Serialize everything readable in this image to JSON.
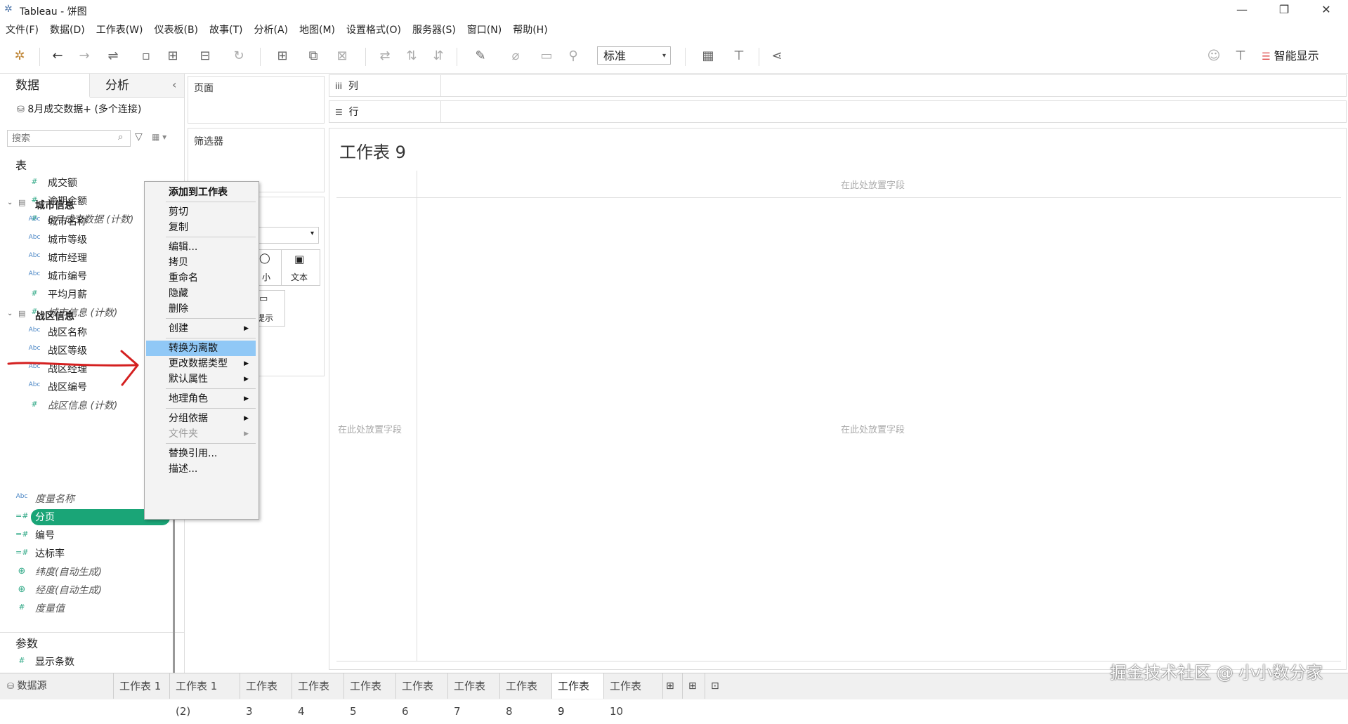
{
  "window": {
    "title": "Tableau - 饼图",
    "minimize": "—",
    "maximize": "❐",
    "close": "✕"
  },
  "menu": [
    "文件(F)",
    "数据(D)",
    "工作表(W)",
    "仪表板(B)",
    "故事(T)",
    "分析(A)",
    "地图(M)",
    "设置格式(O)",
    "服务器(S)",
    "窗口(N)",
    "帮助(H)"
  ],
  "toolbar": {
    "view_size": "标准",
    "show_me": "智能显示"
  },
  "left_panel": {
    "tab_data": "数据",
    "tab_analysis": "分析",
    "collapse": "‹",
    "datasource": "8月成交数据+ (多个连接)",
    "search_placeholder": "搜索",
    "tables_header": "表",
    "table_fields": [
      {
        "name": "成交额",
        "icon": "#",
        "italic": false
      },
      {
        "name": "逾期金额",
        "icon": "#",
        "italic": false
      },
      {
        "name": "8月成交数据 (计数)",
        "icon": "#",
        "italic": true
      }
    ],
    "group_city": {
      "name": "城市信息",
      "fields": [
        {
          "name": "城市名称",
          "icon": "Abc",
          "italic": false
        },
        {
          "name": "城市等级",
          "icon": "Abc",
          "italic": false
        },
        {
          "name": "城市经理",
          "icon": "Abc",
          "italic": false
        },
        {
          "name": "城市编号",
          "icon": "Abc",
          "italic": false
        },
        {
          "name": "平均月薪",
          "icon": "#",
          "italic": false
        },
        {
          "name": "城市信息 (计数)",
          "icon": "#",
          "italic": true
        }
      ]
    },
    "group_zone": {
      "name": "战区信息",
      "fields": [
        {
          "name": "战区名称",
          "icon": "Abc",
          "italic": false
        },
        {
          "name": "战区等级",
          "icon": "Abc",
          "italic": false
        },
        {
          "name": "战区经理",
          "icon": "Abc",
          "italic": false
        },
        {
          "name": "战区编号",
          "icon": "Abc",
          "italic": false
        },
        {
          "name": "战区信息 (计数)",
          "icon": "#",
          "italic": true
        }
      ]
    },
    "other_fields": [
      {
        "name": "度量名称",
        "icon": "Abc",
        "italic": true
      },
      {
        "name": "分页",
        "icon": "=#",
        "italic": false,
        "selected": true
      },
      {
        "name": "编号",
        "icon": "=#",
        "italic": false
      },
      {
        "name": "达标率",
        "icon": "=#",
        "italic": false
      },
      {
        "name": "纬度(自动生成)",
        "icon": "⊕",
        "italic": true
      },
      {
        "name": "经度(自动生成)",
        "icon": "⊕",
        "italic": true
      },
      {
        "name": "度量值",
        "icon": "#",
        "italic": true
      }
    ],
    "params_header": "参数",
    "params": [
      {
        "name": "显示条数",
        "icon": "#"
      }
    ]
  },
  "shelves": {
    "pages": "页面",
    "filters": "筛选器",
    "marks_text": "文本",
    "marks_size_fragment": "小",
    "marks_tooltip_fragment": "提示",
    "columns_icon": "iii",
    "columns": "列",
    "rows_icon": "☰",
    "rows": "行"
  },
  "canvas": {
    "title": "工作表 9",
    "drop_hint_col": "在此处放置字段",
    "drop_hint_row": "在此处放置字段",
    "drop_hint_center": "在此处放置字段"
  },
  "context_menu": {
    "items": [
      {
        "label": "添加到工作表",
        "bold": true
      },
      {
        "sep": true
      },
      {
        "label": "剪切"
      },
      {
        "label": "复制"
      },
      {
        "sep": true
      },
      {
        "label": "编辑..."
      },
      {
        "label": "拷贝"
      },
      {
        "label": "重命名"
      },
      {
        "label": "隐藏"
      },
      {
        "label": "删除"
      },
      {
        "sep": true
      },
      {
        "label": "创建",
        "arrow": true
      },
      {
        "sep": true
      },
      {
        "label": "转换为离散",
        "highlight": true
      },
      {
        "label": "更改数据类型",
        "arrow": true
      },
      {
        "label": "默认属性",
        "arrow": true
      },
      {
        "sep": true
      },
      {
        "label": "地理角色",
        "arrow": true
      },
      {
        "sep": true
      },
      {
        "label": "分组依据",
        "arrow": true
      },
      {
        "label": "文件夹",
        "arrow": true,
        "disabled": true
      },
      {
        "sep": true
      },
      {
        "label": "替换引用..."
      },
      {
        "label": "描述..."
      }
    ]
  },
  "tabs": {
    "datasource": "数据源",
    "sheets": [
      "工作表 1",
      "工作表 1 (2)",
      "工作表 3",
      "工作表 4",
      "工作表 5",
      "工作表 6",
      "工作表 7",
      "工作表 8",
      "工作表 9",
      "工作表 10"
    ],
    "active": "工作表 9"
  },
  "watermark": "掘金技术社区 @ 小小数分家",
  "colors": {
    "accent_green": "#1aa577",
    "menu_highlight": "#90c8f6",
    "annotation_red": "#d42020"
  }
}
